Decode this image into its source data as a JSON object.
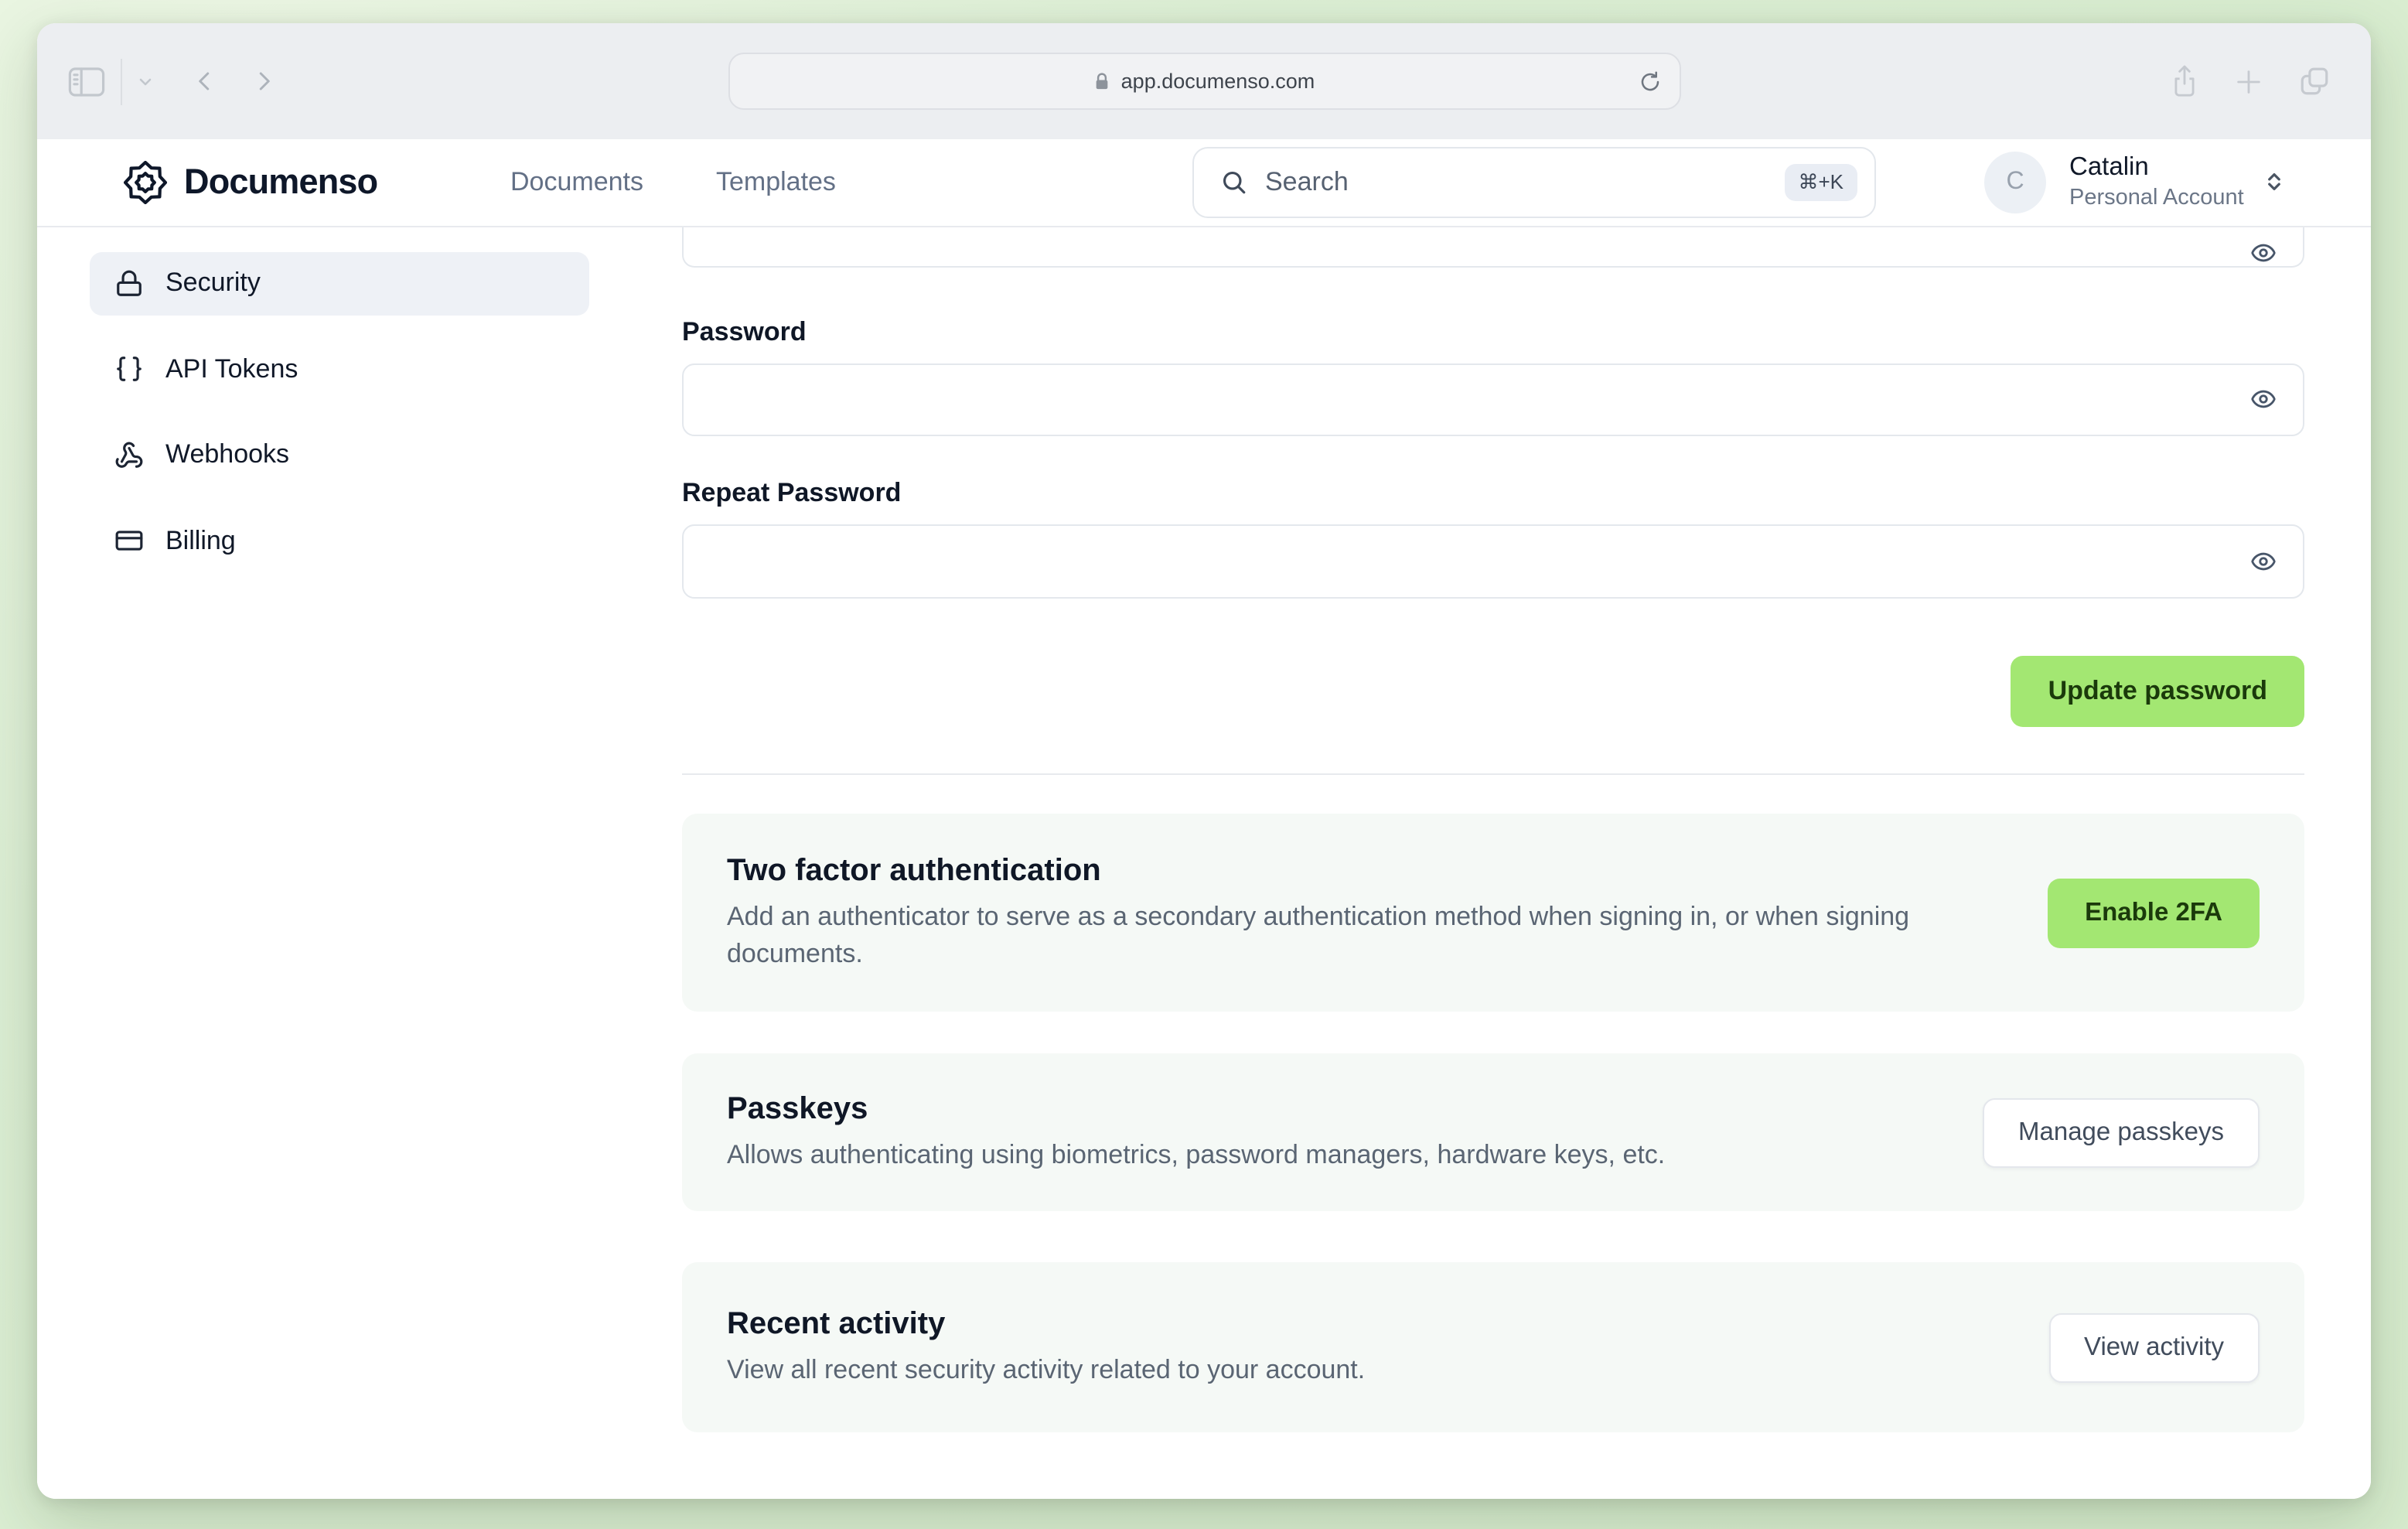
{
  "browser": {
    "url": "app.documenso.com",
    "icons": [
      "sidebar-toggle-icon",
      "chevron-down-icon",
      "back-icon",
      "forward-icon",
      "lock-icon",
      "reload-icon",
      "share-icon",
      "new-tab-icon",
      "tabs-overview-icon"
    ]
  },
  "header": {
    "brand": "Documenso",
    "logo_icon": "documenso-rosette-icon",
    "nav": [
      {
        "label": "Documents"
      },
      {
        "label": "Templates"
      }
    ],
    "search": {
      "placeholder": "Search",
      "shortcut": "⌘+K",
      "icon": "search-icon"
    },
    "account": {
      "initial": "C",
      "name": "Catalin",
      "type": "Personal Account",
      "icon": "chevrons-up-down-icon"
    }
  },
  "sidebar": {
    "items": [
      {
        "label": "Security",
        "icon": "lock-icon",
        "active": true
      },
      {
        "label": "API Tokens",
        "icon": "braces-icon",
        "active": false
      },
      {
        "label": "Webhooks",
        "icon": "webhook-icon",
        "active": false
      },
      {
        "label": "Billing",
        "icon": "credit-card-icon",
        "active": false
      }
    ]
  },
  "main": {
    "form": {
      "top_field": {
        "value": "",
        "icon": "eye-icon"
      },
      "password_label": "Password",
      "password_value": "",
      "repeat_password_label": "Repeat Password",
      "repeat_password_value": "",
      "submit_label": "Update password"
    },
    "cards": [
      {
        "title": "Two factor authentication",
        "description": "Add an authenticator to serve as a secondary authentication method when signing in, or when signing documents.",
        "button": "Enable 2FA",
        "button_style": "green"
      },
      {
        "title": "Passkeys",
        "description": "Allows authenticating using biometrics, password managers, hardware keys, etc.",
        "button": "Manage passkeys",
        "button_style": "outline"
      },
      {
        "title": "Recent activity",
        "description": "View all recent security activity related to your account.",
        "button": "View activity",
        "button_style": "outline"
      }
    ]
  },
  "colors": {
    "accent_green": "#a3e772",
    "accent_green_text": "#1b3a0b",
    "page_background": "#ddefd5",
    "card_background": "#f5f9f6"
  }
}
